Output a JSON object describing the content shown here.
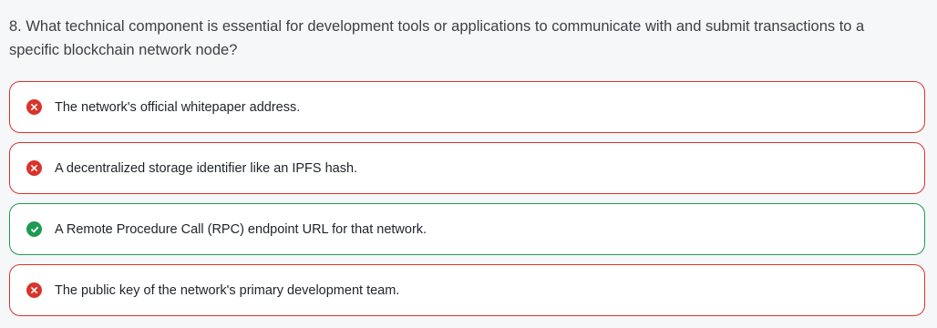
{
  "question": {
    "text": "8. What technical component is essential for development tools or applications to communicate with and submit transactions to a specific blockchain network node?"
  },
  "options": [
    {
      "text": "The network's official whitepaper address.",
      "status": "incorrect",
      "icon": "x-circle-icon"
    },
    {
      "text": "A decentralized storage identifier like an IPFS hash.",
      "status": "incorrect",
      "icon": "x-circle-icon"
    },
    {
      "text": "A Remote Procedure Call (RPC) endpoint URL for that network.",
      "status": "correct",
      "icon": "check-circle-icon"
    },
    {
      "text": "The public key of the network's primary development team.",
      "status": "incorrect",
      "icon": "x-circle-icon"
    }
  ],
  "colors": {
    "incorrect": "#d9342b",
    "correct": "#1f9a55",
    "background": "#f6f7f9"
  }
}
